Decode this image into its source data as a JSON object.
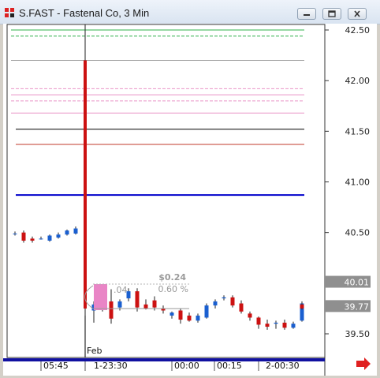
{
  "window": {
    "title": "S.FAST - Fastenal Co, 3 Min",
    "minimize_icon": "minimize-icon",
    "maximize_icon": "maximize-icon",
    "close_icon": "close-icon"
  },
  "chart_data": {
    "type": "candlestick",
    "symbol": "S.FAST",
    "company": "Fastenal Co",
    "interval": "3 Min",
    "ylim": [
      39.35,
      42.55
    ],
    "y_ticks": [
      "42.50",
      "42.00",
      "41.50",
      "41.00",
      "40.50",
      "39.50"
    ],
    "x_ticks": [
      "05:45",
      "1-23:30",
      "00:00",
      "00:15",
      "2-00:30"
    ],
    "date_label": "Feb",
    "price_markers": [
      {
        "label": "40.01",
        "value": 40.01
      },
      {
        "label": "39.77",
        "value": 39.77
      }
    ],
    "annotation": {
      "change": "$0.24",
      "percent": "0.60 %",
      "partial": ".04"
    },
    "levels": [
      {
        "value": 42.5,
        "color": "#2fb04a",
        "style": "solid"
      },
      {
        "value": 42.44,
        "color": "#2fb04a",
        "style": "dashed"
      },
      {
        "value": 42.2,
        "color": "#a0a0a0",
        "style": "solid"
      },
      {
        "value": 41.92,
        "color": "#e995c7",
        "style": "dashed"
      },
      {
        "value": 41.86,
        "color": "#e995c7",
        "style": "solid"
      },
      {
        "value": 41.8,
        "color": "#e995c7",
        "style": "dashed"
      },
      {
        "value": 41.68,
        "color": "#e995c7",
        "style": "solid"
      },
      {
        "value": 41.52,
        "color": "#000000",
        "style": "solid"
      },
      {
        "value": 41.37,
        "color": "#c0392b",
        "style": "solid"
      },
      {
        "value": 40.87,
        "color": "#0000cc",
        "style": "solid"
      }
    ],
    "candles": [
      {
        "o": 40.49,
        "h": 40.51,
        "l": 40.47,
        "c": 40.49
      },
      {
        "o": 40.5,
        "h": 40.52,
        "l": 40.4,
        "c": 40.42
      },
      {
        "o": 40.44,
        "h": 40.46,
        "l": 40.4,
        "c": 40.42
      },
      {
        "o": 40.44,
        "h": 40.46,
        "l": 40.43,
        "c": 40.44
      },
      {
        "o": 40.42,
        "h": 40.48,
        "l": 40.41,
        "c": 40.47
      },
      {
        "o": 40.45,
        "h": 40.5,
        "l": 40.44,
        "c": 40.48
      },
      {
        "o": 40.48,
        "h": 40.53,
        "l": 40.47,
        "c": 40.52
      },
      {
        "o": 40.49,
        "h": 40.56,
        "l": 40.48,
        "c": 40.54
      },
      {
        "o": 42.2,
        "h": 42.55,
        "l": 39.68,
        "c": 39.75
      },
      {
        "o": 39.73,
        "h": 39.82,
        "l": 39.61,
        "c": 39.79
      },
      {
        "o": 39.76,
        "h": 39.86,
        "l": 39.72,
        "c": 39.79
      },
      {
        "o": 39.82,
        "h": 39.94,
        "l": 39.6,
        "c": 39.65
      },
      {
        "o": 39.76,
        "h": 39.84,
        "l": 39.73,
        "c": 39.82
      },
      {
        "o": 39.85,
        "h": 39.95,
        "l": 39.82,
        "c": 39.92
      },
      {
        "o": 39.92,
        "h": 39.95,
        "l": 39.72,
        "c": 39.76
      },
      {
        "o": 39.79,
        "h": 39.84,
        "l": 39.74,
        "c": 39.75
      },
      {
        "o": 39.83,
        "h": 39.87,
        "l": 39.73,
        "c": 39.76
      },
      {
        "o": 39.75,
        "h": 39.78,
        "l": 39.7,
        "c": 39.73
      },
      {
        "o": 39.68,
        "h": 39.72,
        "l": 39.65,
        "c": 39.71
      },
      {
        "o": 39.73,
        "h": 39.75,
        "l": 39.6,
        "c": 39.64
      },
      {
        "o": 39.68,
        "h": 39.71,
        "l": 39.62,
        "c": 39.63
      },
      {
        "o": 39.63,
        "h": 39.7,
        "l": 39.61,
        "c": 39.68
      },
      {
        "o": 39.66,
        "h": 39.8,
        "l": 39.65,
        "c": 39.78
      },
      {
        "o": 39.78,
        "h": 39.84,
        "l": 39.75,
        "c": 39.82
      },
      {
        "o": 39.85,
        "h": 39.88,
        "l": 39.83,
        "c": 39.86
      },
      {
        "o": 39.86,
        "h": 39.88,
        "l": 39.76,
        "c": 39.78
      },
      {
        "o": 39.8,
        "h": 39.83,
        "l": 39.7,
        "c": 39.72
      },
      {
        "o": 39.7,
        "h": 39.72,
        "l": 39.63,
        "c": 39.66
      },
      {
        "o": 39.66,
        "h": 39.67,
        "l": 39.55,
        "c": 39.59
      },
      {
        "o": 39.6,
        "h": 39.64,
        "l": 39.54,
        "c": 39.57
      },
      {
        "o": 39.6,
        "h": 39.63,
        "l": 39.55,
        "c": 39.61
      },
      {
        "o": 39.61,
        "h": 39.64,
        "l": 39.54,
        "c": 39.56
      },
      {
        "o": 39.56,
        "h": 39.62,
        "l": 39.55,
        "c": 39.6
      },
      {
        "o": 39.63,
        "h": 39.82,
        "l": 39.62,
        "c": 39.8
      },
      {
        "o": 39.79,
        "h": 39.81,
        "l": 39.74,
        "c": 39.75
      }
    ]
  }
}
